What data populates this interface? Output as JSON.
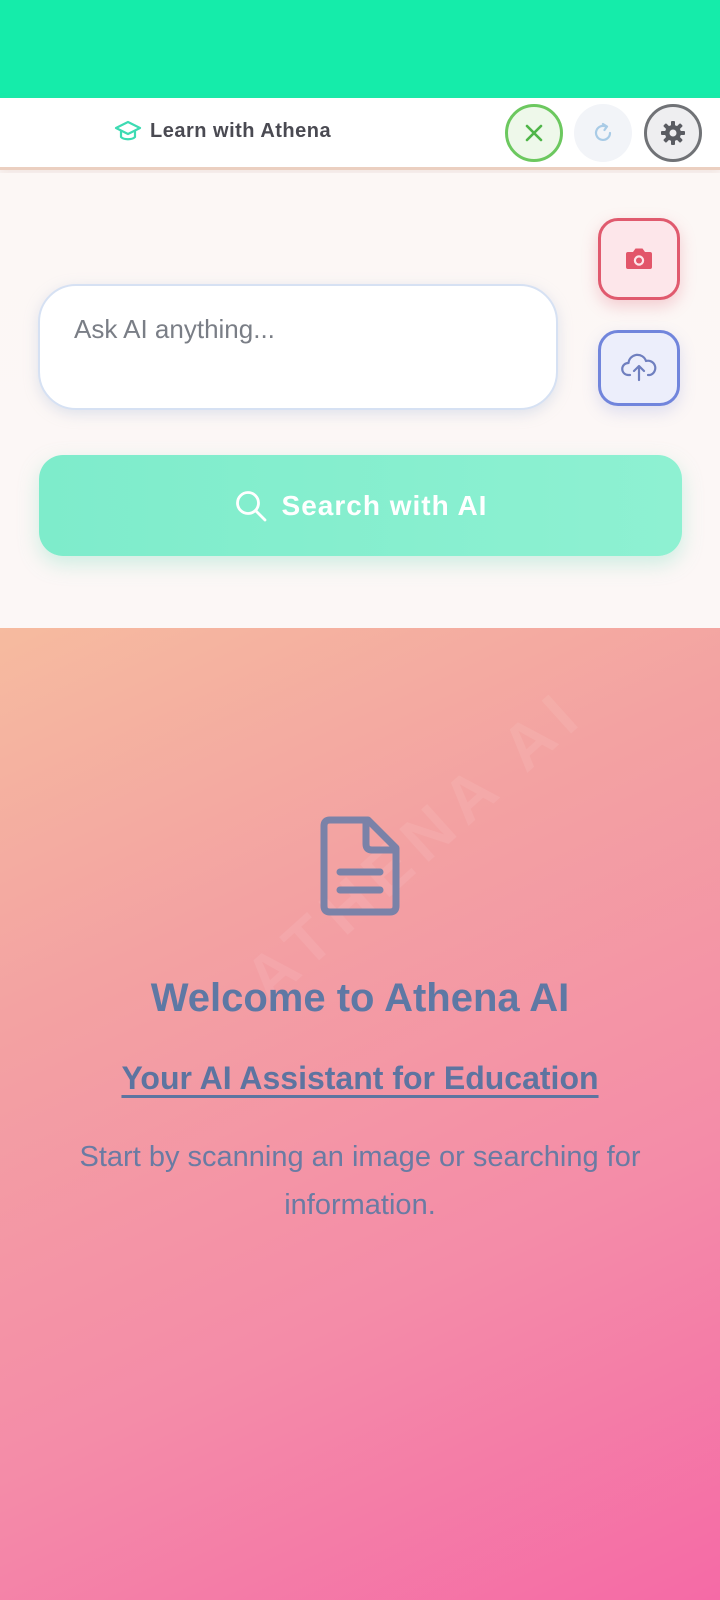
{
  "header": {
    "title": "Learn with Athena",
    "icons": {
      "brand": "graduation-cap-icon",
      "close": "close-icon",
      "refresh": "refresh-icon",
      "settings": "gear-icon"
    }
  },
  "search": {
    "placeholder": "Ask AI anything...",
    "button_label": "Search with AI",
    "icons": {
      "camera": "camera-icon",
      "upload": "cloud-upload-icon",
      "search": "search-icon"
    }
  },
  "welcome": {
    "title": "Welcome to Athena AI",
    "subtitle": "Your AI Assistant for Education",
    "description": "Start by scanning an image or searching for information.",
    "watermark": "ATHENA AI",
    "icon": "document-icon"
  },
  "colors": {
    "status_bar": "#15ecaa",
    "accent_green": "#7eeccb",
    "camera_red": "#e05a6e",
    "upload_blue": "#7185dc",
    "title_blue": "#5e78a4"
  }
}
